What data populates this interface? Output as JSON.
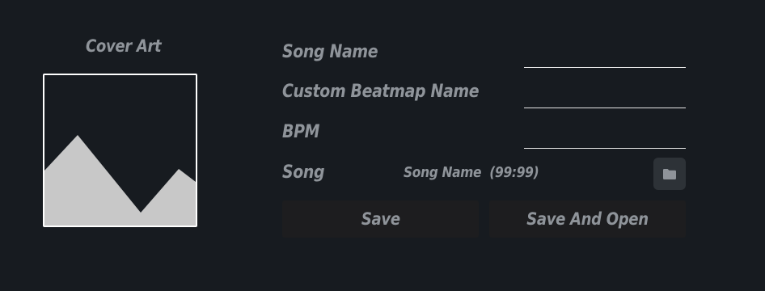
{
  "cover": {
    "title": "Cover Art",
    "icon": "image-placeholder-icon"
  },
  "fields": {
    "song_name_label": "Song Name",
    "song_name_value": "",
    "custom_beatmap_label": "Custom Beatmap Name",
    "custom_beatmap_value": "",
    "bpm_label": "BPM",
    "bpm_value": ""
  },
  "song": {
    "label": "Song",
    "file_display": "Song Name  (99:99)",
    "folder_icon": "folder-icon"
  },
  "actions": {
    "save_label": "Save",
    "save_and_open_label": "Save And Open"
  },
  "colors": {
    "background": "#171b20",
    "text": "#8f949a",
    "button_bg": "#1d1d1f",
    "folder_button_bg": "#2d3237",
    "frame": "#ffffff",
    "mountain": "#c8c8c8"
  }
}
